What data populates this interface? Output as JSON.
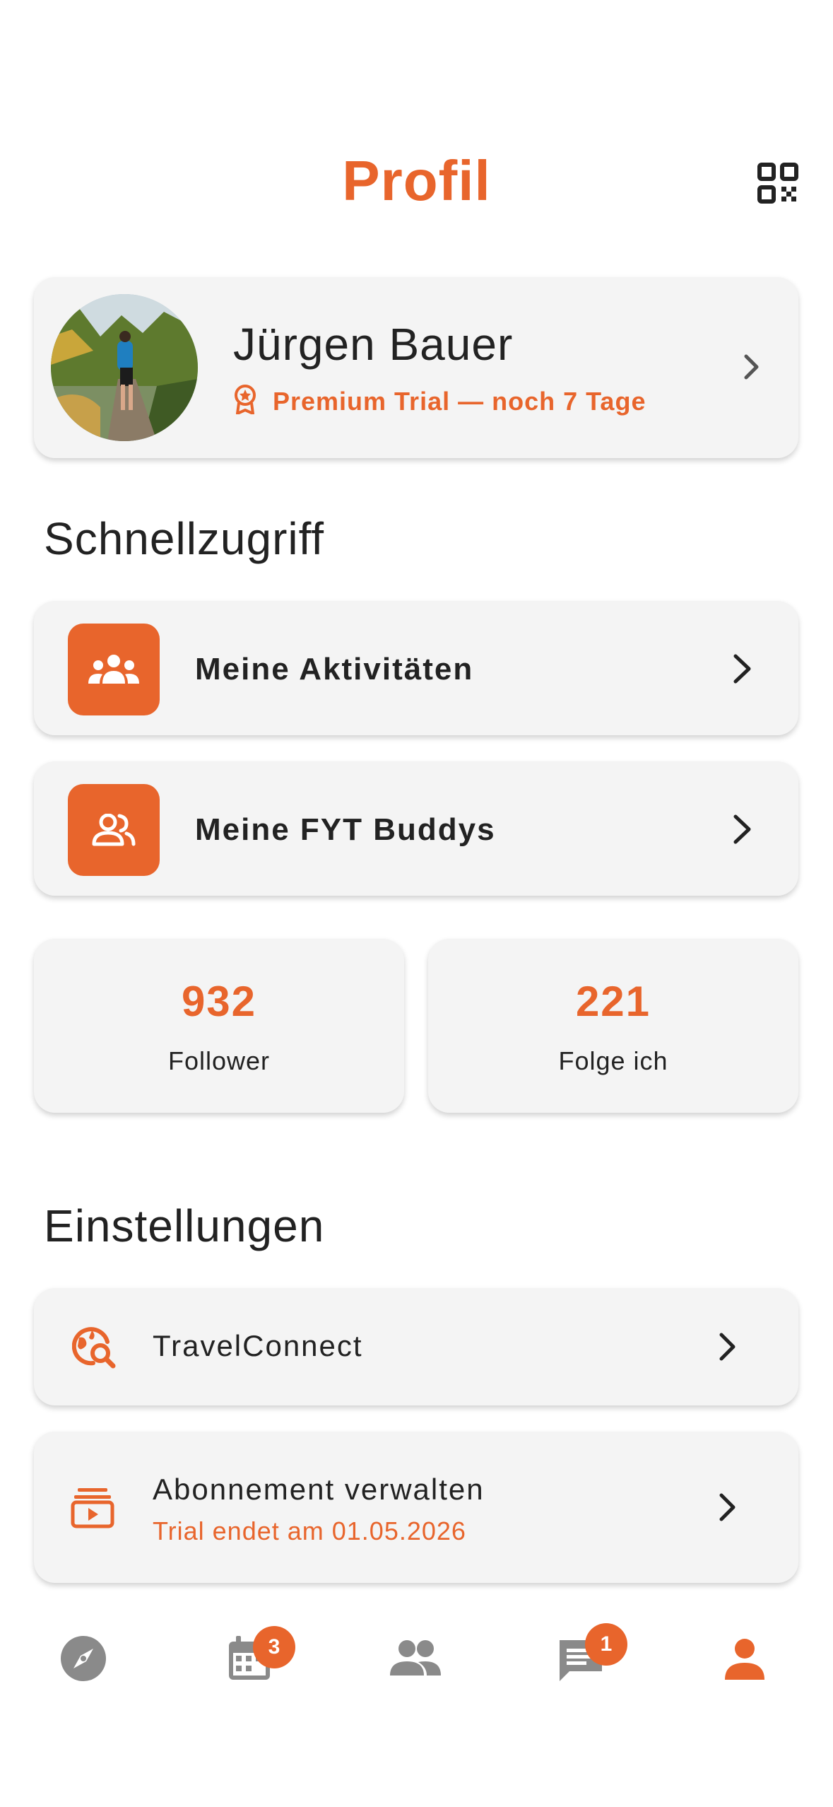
{
  "header": {
    "title": "Profil",
    "qr_icon": "qr-code-icon"
  },
  "profile": {
    "name": "Jürgen Bauer",
    "trial_text": "Premium Trial — noch 7 Tage",
    "award_icon": "award-icon"
  },
  "quick_access": {
    "title": "Schnellzugriff",
    "items": [
      {
        "label": "Meine Aktivitäten",
        "icon": "group-icon"
      },
      {
        "label": "Meine FYT Buddys",
        "icon": "people-icon"
      }
    ]
  },
  "stats": [
    {
      "value": "932",
      "label": "Follower"
    },
    {
      "value": "221",
      "label": "Folge ich"
    }
  ],
  "settings": {
    "title": "Einstellungen",
    "items": [
      {
        "label": "TravelConnect",
        "icon": "travel-explore-icon"
      },
      {
        "label": "Abonnement verwalten",
        "sublabel": "Trial endet am 01.05.2026",
        "icon": "subscriptions-icon"
      }
    ]
  },
  "bottom_nav": {
    "items": [
      {
        "icon": "compass-icon",
        "badge": null,
        "active": false
      },
      {
        "icon": "calendar-icon",
        "badge": "3",
        "active": false
      },
      {
        "icon": "people-icon",
        "badge": null,
        "active": false
      },
      {
        "icon": "chat-icon",
        "badge": "1",
        "active": false
      },
      {
        "icon": "person-icon",
        "badge": null,
        "active": true
      }
    ]
  },
  "colors": {
    "accent": "#E8652C",
    "card": "#f4f4f4",
    "inactive": "#8a8a8a"
  }
}
